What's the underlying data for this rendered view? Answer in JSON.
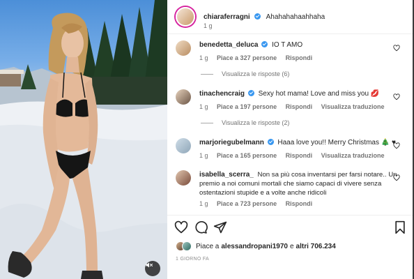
{
  "post": {
    "author": "chiaraferragni",
    "caption": "Ahahahahaahhaha",
    "time": "1 g"
  },
  "comments": [
    {
      "user": "benedetta_deluca",
      "verified": true,
      "text": "IO T AMO",
      "time": "1 g",
      "likes": "Piace a 327 persone",
      "reply": "Rispondi",
      "translate": "",
      "view_replies": "Visualizza le risposte (6)"
    },
    {
      "user": "tinachencraig",
      "verified": true,
      "text": "Sexy hot mama! Love and miss you 💋",
      "time": "1 g",
      "likes": "Piace a 197 persone",
      "reply": "Rispondi",
      "translate": "Visualizza traduzione",
      "view_replies": "Visualizza le risposte (2)"
    },
    {
      "user": "marjoriegubelmann",
      "verified": true,
      "text": "Haaa love you!! Merry Christmas 🎄 ♥",
      "time": "1 g",
      "likes": "Piace a 165 persone",
      "reply": "Rispondi",
      "translate": "Visualizza traduzione",
      "view_replies": ""
    },
    {
      "user": "isabella_scerra_",
      "verified": false,
      "text": "Non sa più cosa inventarsi per farsi notare.. Un premio a noi comuni mortali che siamo capaci di vivere senza ostentazioni stupide e a volte anche ridicoli",
      "time": "1 g",
      "likes": "Piace a 723 persone",
      "reply": "Rispondi",
      "translate": "",
      "view_replies": ""
    }
  ],
  "actions": {
    "like_icon": "heart-icon",
    "comment_icon": "comment-icon",
    "share_icon": "share-icon",
    "save_icon": "bookmark-icon"
  },
  "likes": {
    "prefix": "Piace a",
    "user": "alessandropani1970",
    "middle": "e",
    "others": "altri 706.234"
  },
  "date": "1 GIORNO FA",
  "media": {
    "mute_icon": "speaker-muted-icon"
  },
  "colors": {
    "verified": "#3897f0",
    "text": "#262626",
    "secondary": "#737373",
    "story_ring": "#d6249f"
  }
}
